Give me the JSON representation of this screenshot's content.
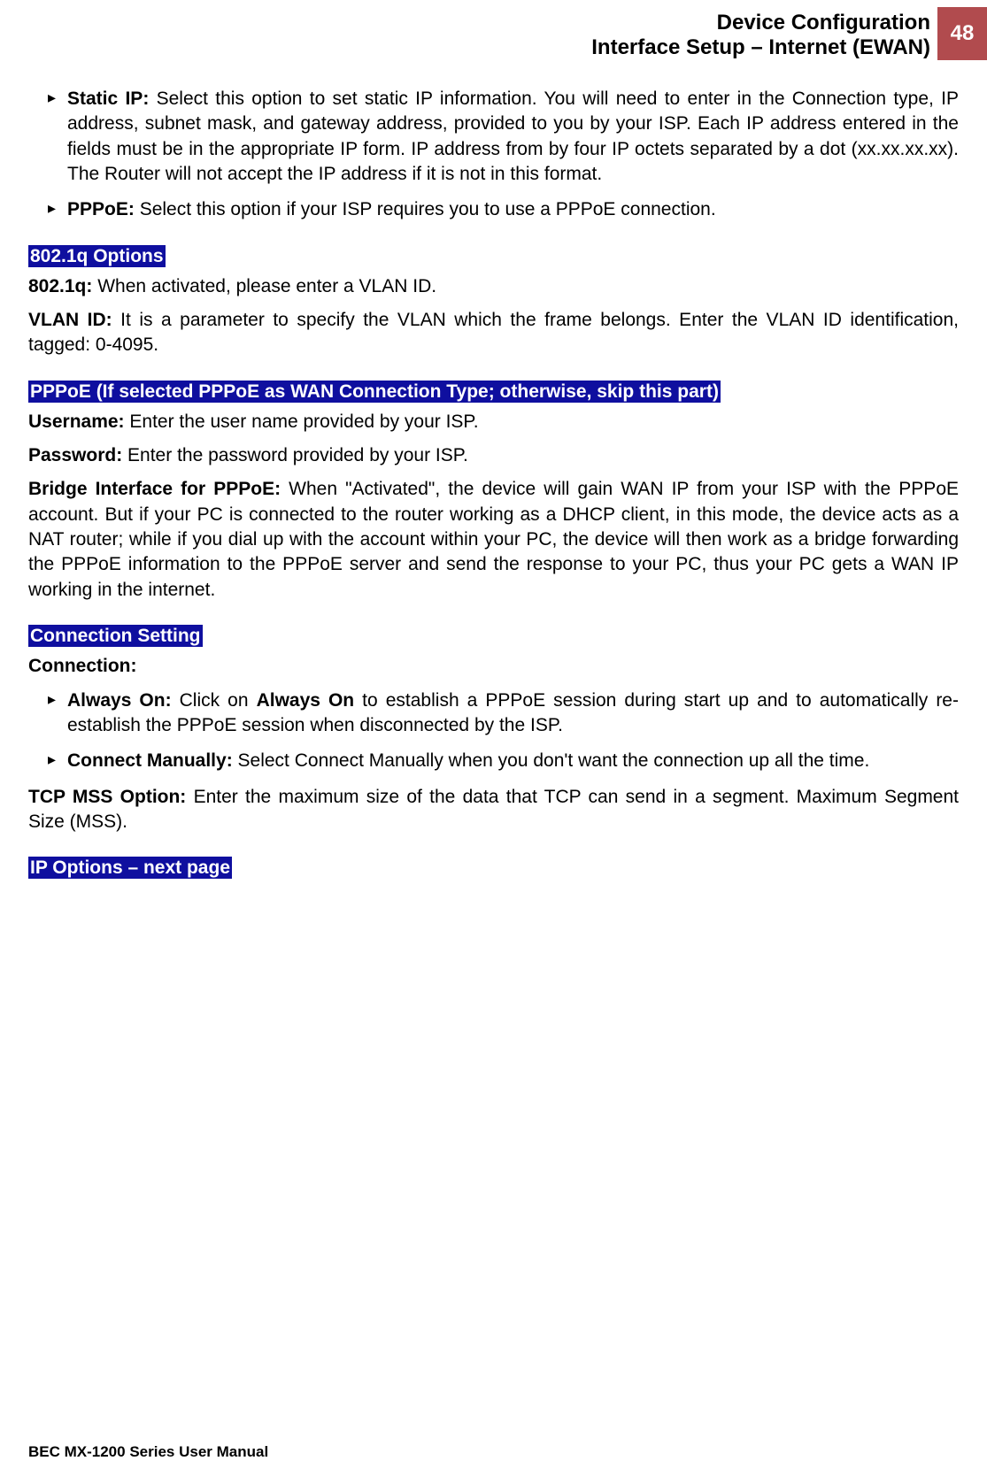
{
  "header": {
    "line1": "Device Configuration",
    "line2": "Interface Setup – Internet (EWAN)",
    "page_number": "48"
  },
  "bullets_top": [
    {
      "term": "Static IP:",
      "text": " Select this option to set static IP information. You will need to enter in the Connection type, IP address, subnet mask, and gateway address, provided to you by your ISP. Each IP address entered in the fields must be in the appropriate IP form.  IP address from by four IP octets separated by a dot (xx.xx.xx.xx). The Router will not accept the IP address if it is not in this format."
    },
    {
      "term": "PPPoE:",
      "text": " Select this option if your ISP requires you to use a PPPoE connection."
    }
  ],
  "section_8021q": {
    "heading": "802.1q Options",
    "p1_term": "802.1q:",
    "p1_text": " When activated, please enter a VLAN ID.",
    "p2_term": "VLAN ID:",
    "p2_text": " It is a parameter to specify the VLAN which the frame belongs. Enter the VLAN ID identification, tagged: 0-4095."
  },
  "section_pppoe": {
    "heading": "PPPoE (If selected PPPoE as WAN Connection Type; otherwise, skip this part)",
    "p1_term": "Username:",
    "p1_text": " Enter the user name provided by your ISP.",
    "p2_term": "Password:",
    "p2_text": " Enter the password provided by your ISP.",
    "p3_term": "Bridge Interface for PPPoE:",
    "p3_text": " When \"Activated\", the device will gain WAN IP from your ISP with the PPPoE account. But if your PC is connected to the router working as a DHCP client, in this mode, the device acts as a NAT router; while if you dial up with the account within your PC, the device will then work as a bridge forwarding the PPPoE information to the PPPoE server and send the response to your PC, thus your PC gets a WAN IP working in the internet."
  },
  "section_connection": {
    "heading": "Connection Setting",
    "p1_term": "Connection:",
    "bullets": [
      {
        "term": "Always On:",
        "text_pre": " Click on ",
        "term2": "Always On",
        "text_post": " to establish a PPPoE session during start up and to automatically re-establish the PPPoE session when disconnected by the ISP."
      },
      {
        "term": "Connect Manually:",
        "text": " Select Connect Manually when you don't want the connection up all the time."
      }
    ],
    "p2_term": "TCP MSS Option:",
    "p2_text": " Enter the maximum size of the data that TCP can send in a segment. Maximum Segment Size (MSS)."
  },
  "section_ip_options": {
    "heading": "IP Options – next page"
  },
  "footer": "BEC MX-1200 Series User Manual"
}
